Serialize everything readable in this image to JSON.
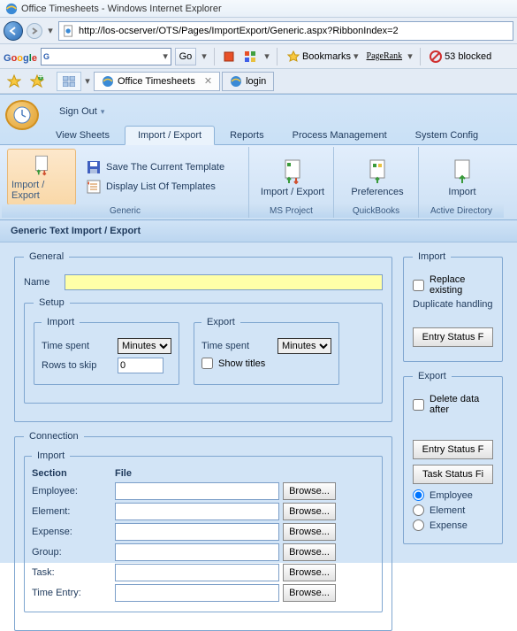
{
  "window": {
    "title": "Office Timesheets - Windows Internet Explorer"
  },
  "nav": {
    "url": "http://los-ocserver/OTS/Pages/ImportExport/Generic.aspx?RibbonIndex=2"
  },
  "google_toolbar": {
    "brand_html": "Google",
    "go_label": "Go",
    "bookmarks_label": "Bookmarks",
    "pagerank_label": "PageRank",
    "blocked_label": "53 blocked"
  },
  "tabs": {
    "t1": "Office Timesheets",
    "t2": "login"
  },
  "ribbon": {
    "signout": "Sign Out",
    "tabs": {
      "view": "View Sheets",
      "ie": "Import / Export",
      "reports": "Reports",
      "process": "Process Management",
      "config": "System Config"
    },
    "groups": {
      "generic": {
        "big": "Import / Export",
        "save_tpl": "Save The Current Template",
        "list_tpl": "Display List Of Templates",
        "label": "Generic"
      },
      "msproj": {
        "big": "Import / Export",
        "label": "MS Project"
      },
      "qb": {
        "big": "Preferences",
        "label": "QuickBooks"
      },
      "ad": {
        "big": "Import",
        "label": "Active Directory"
      }
    }
  },
  "page": {
    "heading": "Generic Text Import / Export",
    "general": {
      "legend": "General",
      "name_label": "Name",
      "name_value": ""
    },
    "setup": {
      "legend": "Setup",
      "import": {
        "legend": "Import",
        "timespent_label": "Time spent",
        "timespent_value": "Minutes",
        "rows_label": "Rows to skip",
        "rows_value": "0"
      },
      "export": {
        "legend": "Export",
        "timespent_label": "Time spent",
        "timespent_value": "Minutes",
        "showtitles_label": "Show titles"
      }
    },
    "connection": {
      "legend": "Connection",
      "import_legend": "Import",
      "col_section": "Section",
      "col_file": "File",
      "browse": "Browse...",
      "rows": {
        "employee": "Employee:",
        "element": "Element:",
        "expense": "Expense:",
        "group": "Group:",
        "task": "Task:",
        "timeentry": "Time Entry:"
      }
    },
    "right_import": {
      "legend": "Import",
      "replace": "Replace existing",
      "dup": "Duplicate handling",
      "entry_btn": "Entry Status F"
    },
    "right_export": {
      "legend": "Export",
      "delete": "Delete data after",
      "entry_btn": "Entry Status F",
      "task_btn": "Task Status Fi",
      "r_employee": "Employee",
      "r_element": "Element",
      "r_expense": "Expense"
    }
  }
}
